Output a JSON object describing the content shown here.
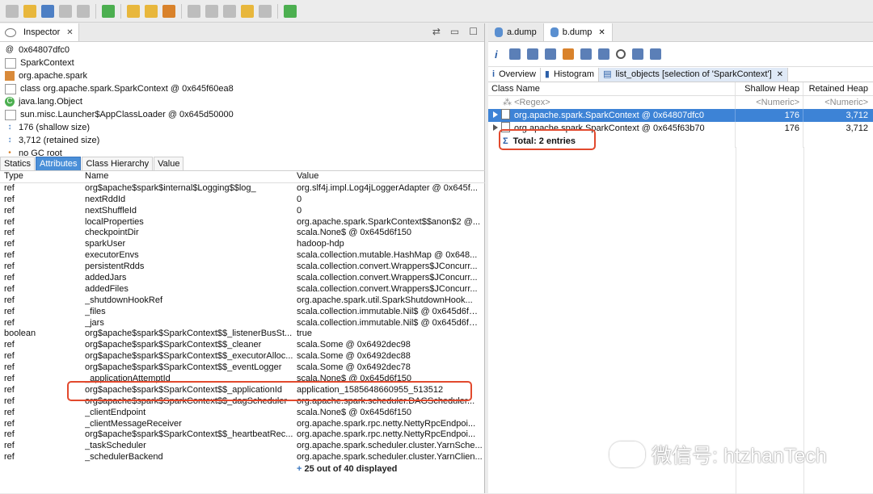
{
  "inspector": {
    "title": "Inspector",
    "info_rows": [
      "0x64807dfc0",
      "SparkContext",
      "org.apache.spark",
      "class org.apache.spark.SparkContext @ 0x645f60ea8",
      "java.lang.Object",
      "sun.misc.Launcher$AppClassLoader @ 0x645d50000",
      "176 (shallow size)",
      "3,712 (retained size)",
      "no GC root"
    ],
    "info_prefix": "@",
    "tabs": [
      "Statics",
      "Attributes",
      "Class Hierarchy",
      "Value"
    ],
    "active_tab": "Attributes",
    "columns": [
      "Type",
      "Name",
      "Value"
    ],
    "rows": [
      [
        "ref",
        "org$apache$spark$internal$Logging$$log_",
        "org.slf4j.impl.Log4jLoggerAdapter @ 0x645f..."
      ],
      [
        "ref",
        "nextRddId",
        "0"
      ],
      [
        "ref",
        "nextShuffleId",
        "0"
      ],
      [
        "ref",
        "localProperties",
        "org.apache.spark.SparkContext$$anon$2 @..."
      ],
      [
        "ref",
        "checkpointDir",
        "scala.None$ @ 0x645d6f150"
      ],
      [
        "ref",
        "sparkUser",
        "hadoop-hdp"
      ],
      [
        "ref",
        "executorEnvs",
        "scala.collection.mutable.HashMap @ 0x648..."
      ],
      [
        "ref",
        "persistentRdds",
        "scala.collection.convert.Wrappers$JConcurr..."
      ],
      [
        "ref",
        "addedJars",
        "scala.collection.convert.Wrappers$JConcurr..."
      ],
      [
        "ref",
        "addedFiles",
        "scala.collection.convert.Wrappers$JConcurr..."
      ],
      [
        "ref",
        "_shutdownHookRef",
        "org.apache.spark.util.SparkShutdownHook..."
      ],
      [
        "ref",
        "_files",
        "scala.collection.immutable.Nil$ @ 0x645d6f190"
      ],
      [
        "ref",
        "_jars",
        "scala.collection.immutable.Nil$ @ 0x645d6f190"
      ],
      [
        "boolean",
        "org$apache$spark$SparkContext$$_listenerBusSt...",
        "true"
      ],
      [
        "ref",
        "org$apache$spark$SparkContext$$_cleaner",
        "scala.Some @ 0x6492dec98"
      ],
      [
        "ref",
        "org$apache$spark$SparkContext$$_executorAlloc...",
        "scala.Some @ 0x6492dec88"
      ],
      [
        "ref",
        "org$apache$spark$SparkContext$$_eventLogger",
        "scala.Some @ 0x6492dec78"
      ],
      [
        "ref",
        "_applicationAttemptId",
        "scala.None$ @ 0x645d6f150"
      ],
      [
        "ref",
        "org$apache$spark$SparkContext$$_applicationId",
        "application_1585648660955_513512"
      ],
      [
        "ref",
        "org$apache$spark$SparkContext$$_dagScheduler",
        "org.apache.spark.scheduler.DAGScheduler..."
      ],
      [
        "ref",
        "_clientEndpoint",
        "scala.None$ @ 0x645d6f150"
      ],
      [
        "ref",
        "_clientMessageReceiver",
        "org.apache.spark.rpc.netty.NettyRpcEndpoi..."
      ],
      [
        "ref",
        "org$apache$spark$SparkContext$$_heartbeatRec...",
        "org.apache.spark.rpc.netty.NettyRpcEndpoi..."
      ],
      [
        "ref",
        "_taskScheduler",
        "org.apache.spark.scheduler.cluster.YarnSche..."
      ],
      [
        "ref",
        "_schedulerBackend",
        "org.apache.spark.scheduler.cluster.YarnClien..."
      ]
    ],
    "footer": "25 out of 40 displayed"
  },
  "editor": {
    "tabs": [
      "a.dump",
      "b.dump"
    ],
    "active_tab": "b.dump",
    "result_tabs": [
      "Overview",
      "Histogram",
      "list_objects  [selection of 'SparkContext']"
    ],
    "active_result_tab": "list_objects  [selection of 'SparkContext']",
    "columns": [
      "Class Name",
      "Shallow Heap",
      "Retained Heap"
    ],
    "filter_row": [
      "<Regex>",
      "<Numeric>",
      "<Numeric>"
    ],
    "rows": [
      [
        "org.apache.spark.SparkContext @ 0x64807dfc0",
        "176",
        "3,712"
      ],
      [
        "org.apache.spark.SparkContext @ 0x645f63b70",
        "176",
        "3,712"
      ]
    ],
    "total": "Total: 2 entries"
  },
  "watermark": "微信号: htzhanTech",
  "colors": {
    "selection": "#3d83d6",
    "highlight_box": "#e2492d",
    "tab_active": "#4a8fd8"
  }
}
